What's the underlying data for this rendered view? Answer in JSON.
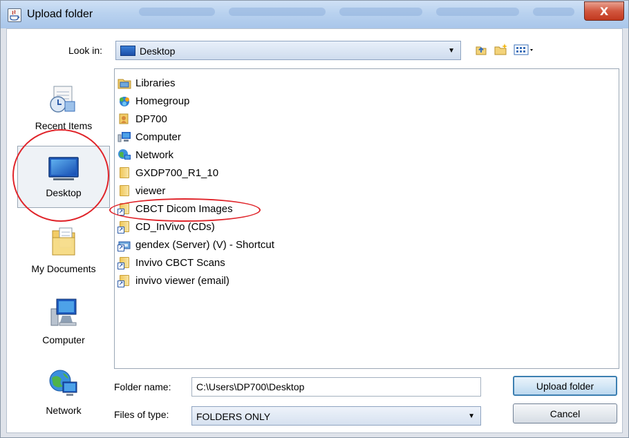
{
  "window": {
    "title": "Upload folder",
    "close_glyph": "X"
  },
  "toolbar": {
    "look_in_label": "Look in:",
    "look_in_value": "Desktop",
    "up_icon": "up-folder-icon",
    "new_folder_icon": "new-folder-icon",
    "view_menu_icon": "view-menu-icon"
  },
  "places": [
    {
      "label": "Recent Items",
      "icon": "recent-items-icon"
    },
    {
      "label": "Desktop",
      "icon": "desktop-icon",
      "selected": true
    },
    {
      "label": "My Documents",
      "icon": "my-documents-icon"
    },
    {
      "label": "Computer",
      "icon": "computer-icon"
    },
    {
      "label": "Network",
      "icon": "network-icon"
    }
  ],
  "files": [
    {
      "name": "Libraries",
      "icon": "libraries-icon"
    },
    {
      "name": "Homegroup",
      "icon": "homegroup-icon"
    },
    {
      "name": "DP700",
      "icon": "user-folder-icon"
    },
    {
      "name": "Computer",
      "icon": "computer-icon"
    },
    {
      "name": "Network",
      "icon": "network-icon"
    },
    {
      "name": "GXDP700_R1_10",
      "icon": "folder-icon"
    },
    {
      "name": "viewer",
      "icon": "folder-icon"
    },
    {
      "name": "CBCT Dicom Images",
      "icon": "shortcut-folder-icon"
    },
    {
      "name": "CD_InVivo (CDs)",
      "icon": "shortcut-folder-icon"
    },
    {
      "name": "gendex (Server) (V) - Shortcut",
      "icon": "network-drive-shortcut-icon"
    },
    {
      "name": "Invivo CBCT Scans",
      "icon": "shortcut-folder-icon"
    },
    {
      "name": "invivo viewer (email)",
      "icon": "shortcut-folder-icon"
    }
  ],
  "form": {
    "folder_name_label": "Folder name:",
    "folder_name_value": "C:\\Users\\DP700\\Desktop",
    "files_of_type_label": "Files of type:",
    "files_of_type_value": "FOLDERS ONLY"
  },
  "buttons": {
    "upload": "Upload folder",
    "cancel": "Cancel"
  },
  "colors": {
    "annotation_red": "#e0242a",
    "primary_button_border": "#3c7fb1"
  }
}
